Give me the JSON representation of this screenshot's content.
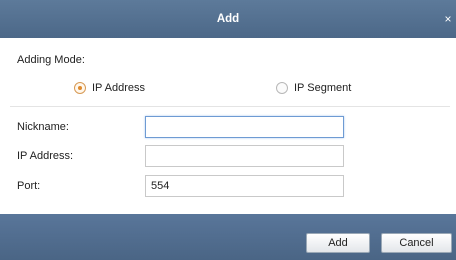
{
  "dialog": {
    "title": "Add",
    "close_glyph": "×"
  },
  "adding_mode": {
    "label": "Adding Mode:",
    "options": [
      {
        "label": "IP Address",
        "selected": true
      },
      {
        "label": "IP Segment",
        "selected": false
      }
    ]
  },
  "fields": {
    "nickname": {
      "label": "Nickname:",
      "value": ""
    },
    "ip_address": {
      "label": "IP Address:",
      "value": ""
    },
    "port": {
      "label": "Port:",
      "value": "554"
    }
  },
  "buttons": {
    "add": "Add",
    "cancel": "Cancel"
  },
  "colors": {
    "titlebar": "#4c6888",
    "footer": "#4a6585",
    "radio_selected": "#e08a2c",
    "focus_border": "#6e9bd3"
  }
}
